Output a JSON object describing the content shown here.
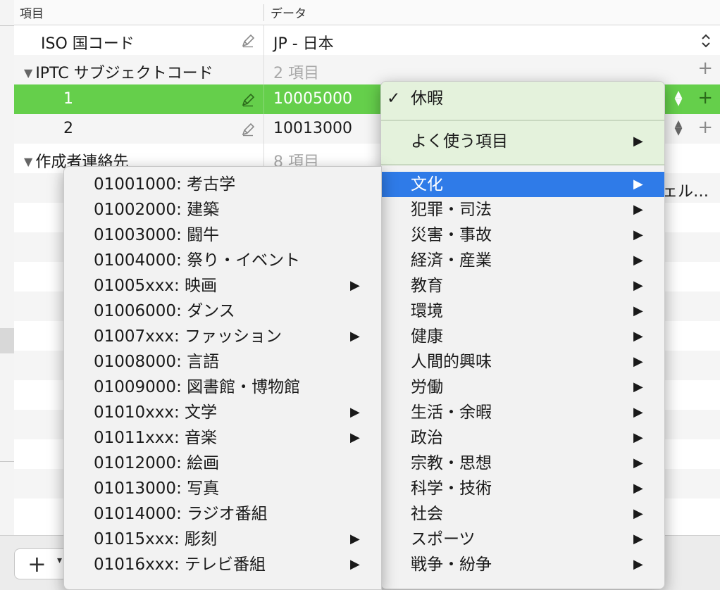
{
  "table": {
    "headers": {
      "item": "項目",
      "data": "データ"
    },
    "rows": [
      {
        "label": "ISO 国コード",
        "value": "JP - 日本"
      },
      {
        "label": "IPTC サブジェクトコード",
        "value": "2 項目"
      },
      {
        "label": "1",
        "value": "10005000"
      },
      {
        "label": "2",
        "value": "10013000"
      },
      {
        "label": "作成者連絡先",
        "value": "8 項目"
      }
    ],
    "overflow_text": "ェル…"
  },
  "icons": {
    "pencil": "pencil-icon",
    "disclosure": "disclosure-triangle-icon",
    "plus": "plus-icon",
    "stepper": "up-down-arrows-icon",
    "submenu": "submenu-arrow-icon"
  },
  "symbols": {
    "expanded": "▼",
    "plus": "+",
    "up": "▲",
    "down": "▼",
    "updown": "⌃⌄",
    "check": "✓",
    "submenu": "▶",
    "caret": "▾"
  },
  "menu_right": {
    "checked": "休暇",
    "frequent": "よく使う項目",
    "items": [
      "文化",
      "犯罪・司法",
      "災害・事故",
      "経済・産業",
      "教育",
      "環境",
      "健康",
      "人間的興味",
      "労働",
      "生活・余暇",
      "政治",
      "宗教・思想",
      "科学・技術",
      "社会",
      "スポーツ",
      "戦争・紛争"
    ],
    "highlighted_index": 0
  },
  "menu_left": {
    "items": [
      {
        "label": "01001000: 考古学",
        "submenu": false
      },
      {
        "label": "01002000: 建築",
        "submenu": false
      },
      {
        "label": "01003000: 闘牛",
        "submenu": false
      },
      {
        "label": "01004000: 祭り・イベント",
        "submenu": false
      },
      {
        "label": "01005xxx: 映画",
        "submenu": true
      },
      {
        "label": "01006000: ダンス",
        "submenu": false
      },
      {
        "label": "01007xxx: ファッション",
        "submenu": true
      },
      {
        "label": "01008000: 言語",
        "submenu": false
      },
      {
        "label": "01009000: 図書館・博物館",
        "submenu": false
      },
      {
        "label": "01010xxx: 文学",
        "submenu": true
      },
      {
        "label": "01011xxx: 音楽",
        "submenu": true
      },
      {
        "label": "01012000: 絵画",
        "submenu": false
      },
      {
        "label": "01013000: 写真",
        "submenu": false
      },
      {
        "label": "01014000: ラジオ番組",
        "submenu": false
      },
      {
        "label": "01015xxx: 彫刻",
        "submenu": true
      },
      {
        "label": "01016xxx: テレビ番組",
        "submenu": true
      }
    ]
  },
  "bottombar": {
    "add_label": "+"
  },
  "colors": {
    "selection_green": "#65cf4b",
    "highlight_blue": "#2f7be8",
    "menu_bg": "#f2f2f2"
  }
}
